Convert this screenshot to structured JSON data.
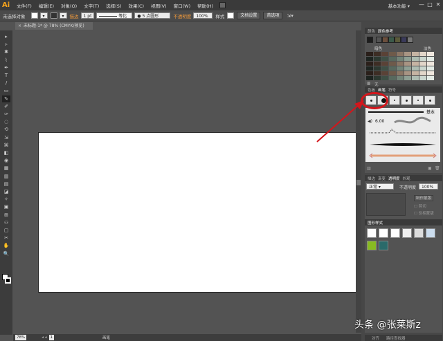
{
  "app": {
    "logo": "Ai",
    "workspace": "基本功能 ▾"
  },
  "menu": [
    "文件(F)",
    "编辑(E)",
    "对象(O)",
    "文字(T)",
    "选择(S)",
    "效果(C)",
    "视图(V)",
    "窗口(W)",
    "帮助(H)"
  ],
  "window_controls": {
    "minimize": "—",
    "maximize": "□",
    "close": "✕"
  },
  "control_bar": {
    "selection": "未选择对象",
    "stroke_label": "描边",
    "stroke_weight": "1 pt",
    "stroke_profile": "等比",
    "brush": "● 5 点圆形",
    "opacity_label": "不透明度",
    "opacity_value": "100%",
    "style_label": "样式",
    "doc_setup": "文档设置",
    "prefs": "首选项"
  },
  "document": {
    "tab_title": "未标题-1* @ 78% (CMYK/预览)",
    "close": "×"
  },
  "tools": [
    "▸",
    "▹",
    "✱",
    "⌇",
    "✒",
    "T",
    "/",
    "▭",
    "✎",
    "✐",
    "✑",
    "◌",
    "⟲",
    "⇲",
    "⌘",
    "◧",
    "◉",
    "▦",
    "▥",
    "▤",
    "◪",
    "✧",
    "▣",
    "⊞",
    "⚇",
    "▢",
    "✂",
    "✋",
    "🔍"
  ],
  "status": {
    "zoom": "78%",
    "page": "1",
    "tool": "画笔"
  },
  "panels": {
    "color_tabs": [
      "颜色",
      "颜色参考"
    ],
    "guide_labels": {
      "left": "暗色",
      "right": "淡色"
    },
    "guide_footer": "无",
    "brush_tabs": [
      "色板",
      "画笔",
      "符号"
    ],
    "brush_basic": "基本",
    "brush_size": "6.00",
    "transp_tabs": [
      "描边",
      "渐变",
      "透明度",
      "外观"
    ],
    "blend_mode": "正常",
    "opacity_label": "不透明度",
    "opacity_value": "100%",
    "make_mask": "制作蒙版",
    "clip": "剪切",
    "invert": "反相蒙版",
    "graphic_styles_tab": "图形样式",
    "bottom_tabs": [
      "对齐",
      "路径查找器"
    ]
  },
  "watermark": "头条 @张莱斯z",
  "colors": {
    "accent": "#f7a41d",
    "annotation": "#d4151b"
  }
}
